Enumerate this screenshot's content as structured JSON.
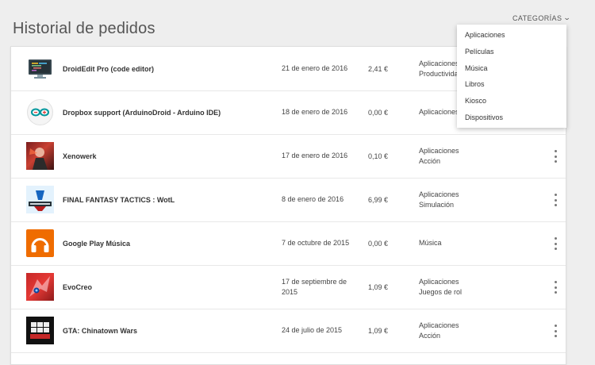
{
  "header": {
    "title": "Historial de pedidos",
    "categories_label": "CATEGORÍAS"
  },
  "dropdown": {
    "items": [
      "Aplicaciones",
      "Películas",
      "Música",
      "Libros",
      "Kiosco",
      "Dispositivos"
    ]
  },
  "orders": [
    {
      "name": "DroidEdit Pro (code editor)",
      "date": "21 de enero de 2016",
      "price": "2,41 €",
      "category1": "Aplicaciones",
      "category2": "Productividad",
      "icon": "droidedit-icon"
    },
    {
      "name": "Dropbox support (ArduinoDroid - Arduino IDE)",
      "date": "18 de enero de 2016",
      "price": "0,00 €",
      "category1": "Aplicaciones",
      "category2": "",
      "icon": "arduino-icon"
    },
    {
      "name": "Xenowerk",
      "date": "17 de enero de 2016",
      "price": "0,10 €",
      "category1": "Aplicaciones",
      "category2": "Acción",
      "icon": "xenowerk-icon"
    },
    {
      "name": "FINAL FANTASY TACTICS : WotL",
      "date": "8 de enero de 2016",
      "price": "6,99 €",
      "category1": "Aplicaciones",
      "category2": "Simulación",
      "icon": "fft-icon"
    },
    {
      "name": "Google Play Música",
      "date": "7 de octubre de 2015",
      "price": "0,00 €",
      "category1": "Música",
      "category2": "",
      "icon": "headphones-icon"
    },
    {
      "name": "EvoCreo",
      "date": "17 de septiembre de 2015",
      "price": "1,09 €",
      "category1": "Aplicaciones",
      "category2": "Juegos de rol",
      "icon": "evocreo-icon"
    },
    {
      "name": "GTA: Chinatown Wars",
      "date": "24 de julio de 2015",
      "price": "1,09 €",
      "category1": "Aplicaciones",
      "category2": "Acción",
      "icon": "gta-icon"
    }
  ]
}
